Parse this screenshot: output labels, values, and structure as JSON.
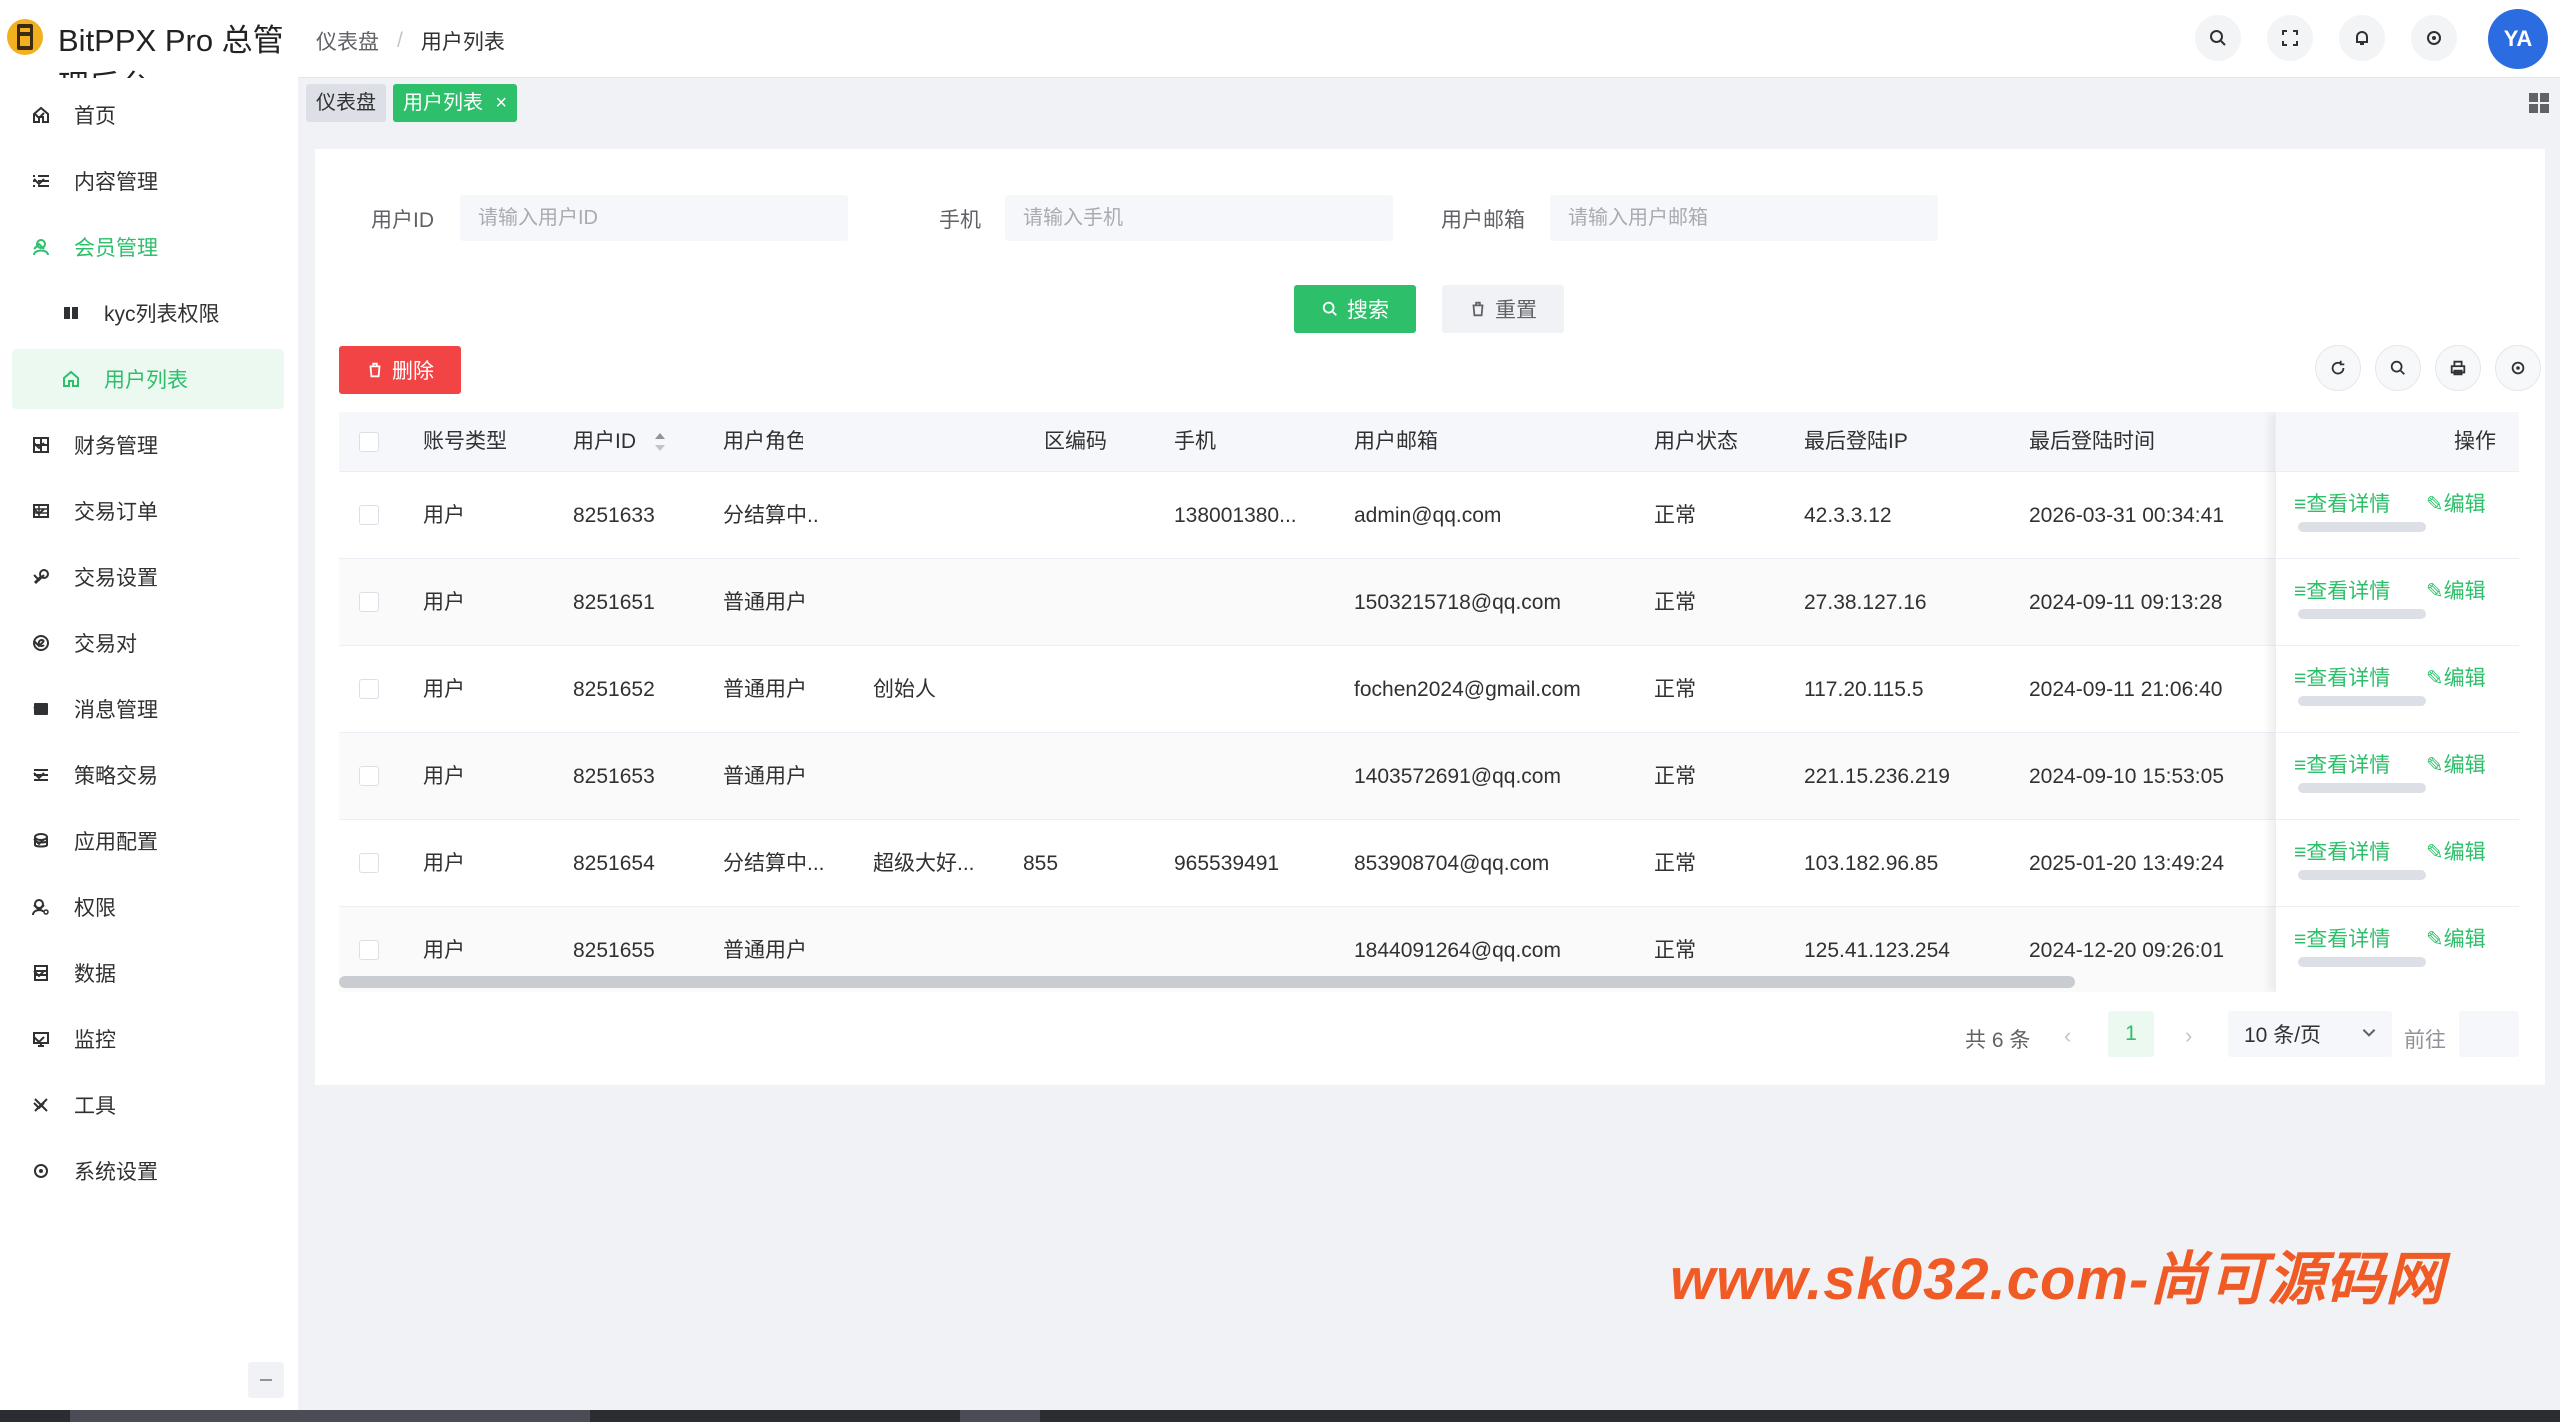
{
  "app": {
    "title": "BitPPX Pro 总管理后台"
  },
  "header": {
    "breadcrumb": [
      "仪表盘",
      "用户列表"
    ],
    "avatar_text": "YA"
  },
  "sidebar": {
    "items": [
      {
        "label": "首页",
        "icon": "home-icon"
      },
      {
        "label": "内容管理",
        "icon": "list-icon"
      },
      {
        "label": "会员管理",
        "icon": "user-icon"
      },
      {
        "label": "kyc列表权限",
        "icon": "book-icon"
      },
      {
        "label": "用户列表",
        "icon": "home-icon"
      },
      {
        "label": "财务管理",
        "icon": "grid-icon"
      },
      {
        "label": "交易订单",
        "icon": "table-icon"
      },
      {
        "label": "交易设置",
        "icon": "wrench-icon"
      },
      {
        "label": "交易对",
        "icon": "copyright-icon"
      },
      {
        "label": "消息管理",
        "icon": "message-icon"
      },
      {
        "label": "策略交易",
        "icon": "menu-icon"
      },
      {
        "label": "应用配置",
        "icon": "coins-icon"
      },
      {
        "label": "权限",
        "icon": "user-key-icon"
      },
      {
        "label": "数据",
        "icon": "database-icon"
      },
      {
        "label": "监控",
        "icon": "monitor-icon"
      },
      {
        "label": "工具",
        "icon": "tools-icon"
      },
      {
        "label": "系统设置",
        "icon": "gear-icon"
      }
    ]
  },
  "tabs": [
    {
      "label": "仪表盘"
    },
    {
      "label": "用户列表",
      "close": "×"
    }
  ],
  "search_form": {
    "user_id_label": "用户ID",
    "user_id_placeholder": "请输入用户ID",
    "phone_label": "手机",
    "phone_placeholder": "请输入手机",
    "email_label": "用户邮箱",
    "email_placeholder": "请输入用户邮箱",
    "search_button": "搜索",
    "reset_button": "重置"
  },
  "toolbar": {
    "delete_button": "删除"
  },
  "table": {
    "columns": [
      "账号类型",
      "用户ID",
      "用户角色",
      "区编码",
      "手机",
      "用户邮箱",
      "用户状态",
      "最后登陆IP",
      "最后登陆时间",
      "操作"
    ],
    "rows": [
      {
        "type": "用户",
        "id": "8251633",
        "role": "分结算中..",
        "nick": "",
        "code": "",
        "phone": "138001380...",
        "email": "admin@qq.com",
        "status": "正常",
        "ip": "42.3.3.12",
        "time": "2026-03-31 00:34:41"
      },
      {
        "type": "用户",
        "id": "8251651",
        "role": "普通用户",
        "nick": "",
        "code": "",
        "phone": "",
        "email": "1503215718@qq.com",
        "status": "正常",
        "ip": "27.38.127.16",
        "time": "2024-09-11 09:13:28"
      },
      {
        "type": "用户",
        "id": "8251652",
        "role": "普通用户",
        "nick": "创始人",
        "code": "",
        "phone": "",
        "email": "fochen2024@gmail.com",
        "status": "正常",
        "ip": "117.20.115.5",
        "time": "2024-09-11 21:06:40"
      },
      {
        "type": "用户",
        "id": "8251653",
        "role": "普通用户",
        "nick": "",
        "code": "",
        "phone": "",
        "email": "1403572691@qq.com",
        "status": "正常",
        "ip": "221.15.236.219",
        "time": "2024-09-10 15:53:05"
      },
      {
        "type": "用户",
        "id": "8251654",
        "role": "分结算中...",
        "nick": "超级大好...",
        "code": "855",
        "phone": "965539491",
        "email": "853908704@qq.com",
        "status": "正常",
        "ip": "103.182.96.85",
        "time": "2025-01-20 13:49:24"
      },
      {
        "type": "用户",
        "id": "8251655",
        "role": "普通用户",
        "nick": "",
        "code": "",
        "phone": "",
        "email": "1844091264@qq.com",
        "status": "正常",
        "ip": "125.41.123.254",
        "time": "2024-12-20 09:26:01"
      }
    ],
    "op_view": "≡查看详情",
    "op_edit": "✎编辑"
  },
  "pagination": {
    "total": "共 6 条",
    "current_page": "1",
    "page_size": "10 条/页",
    "goto_label": "前往"
  },
  "watermark": "www.sk032.com-尚可源码网",
  "colors": {
    "primary": "#2dbf6a",
    "danger": "#f24444",
    "watermark": "#ef5a25"
  }
}
